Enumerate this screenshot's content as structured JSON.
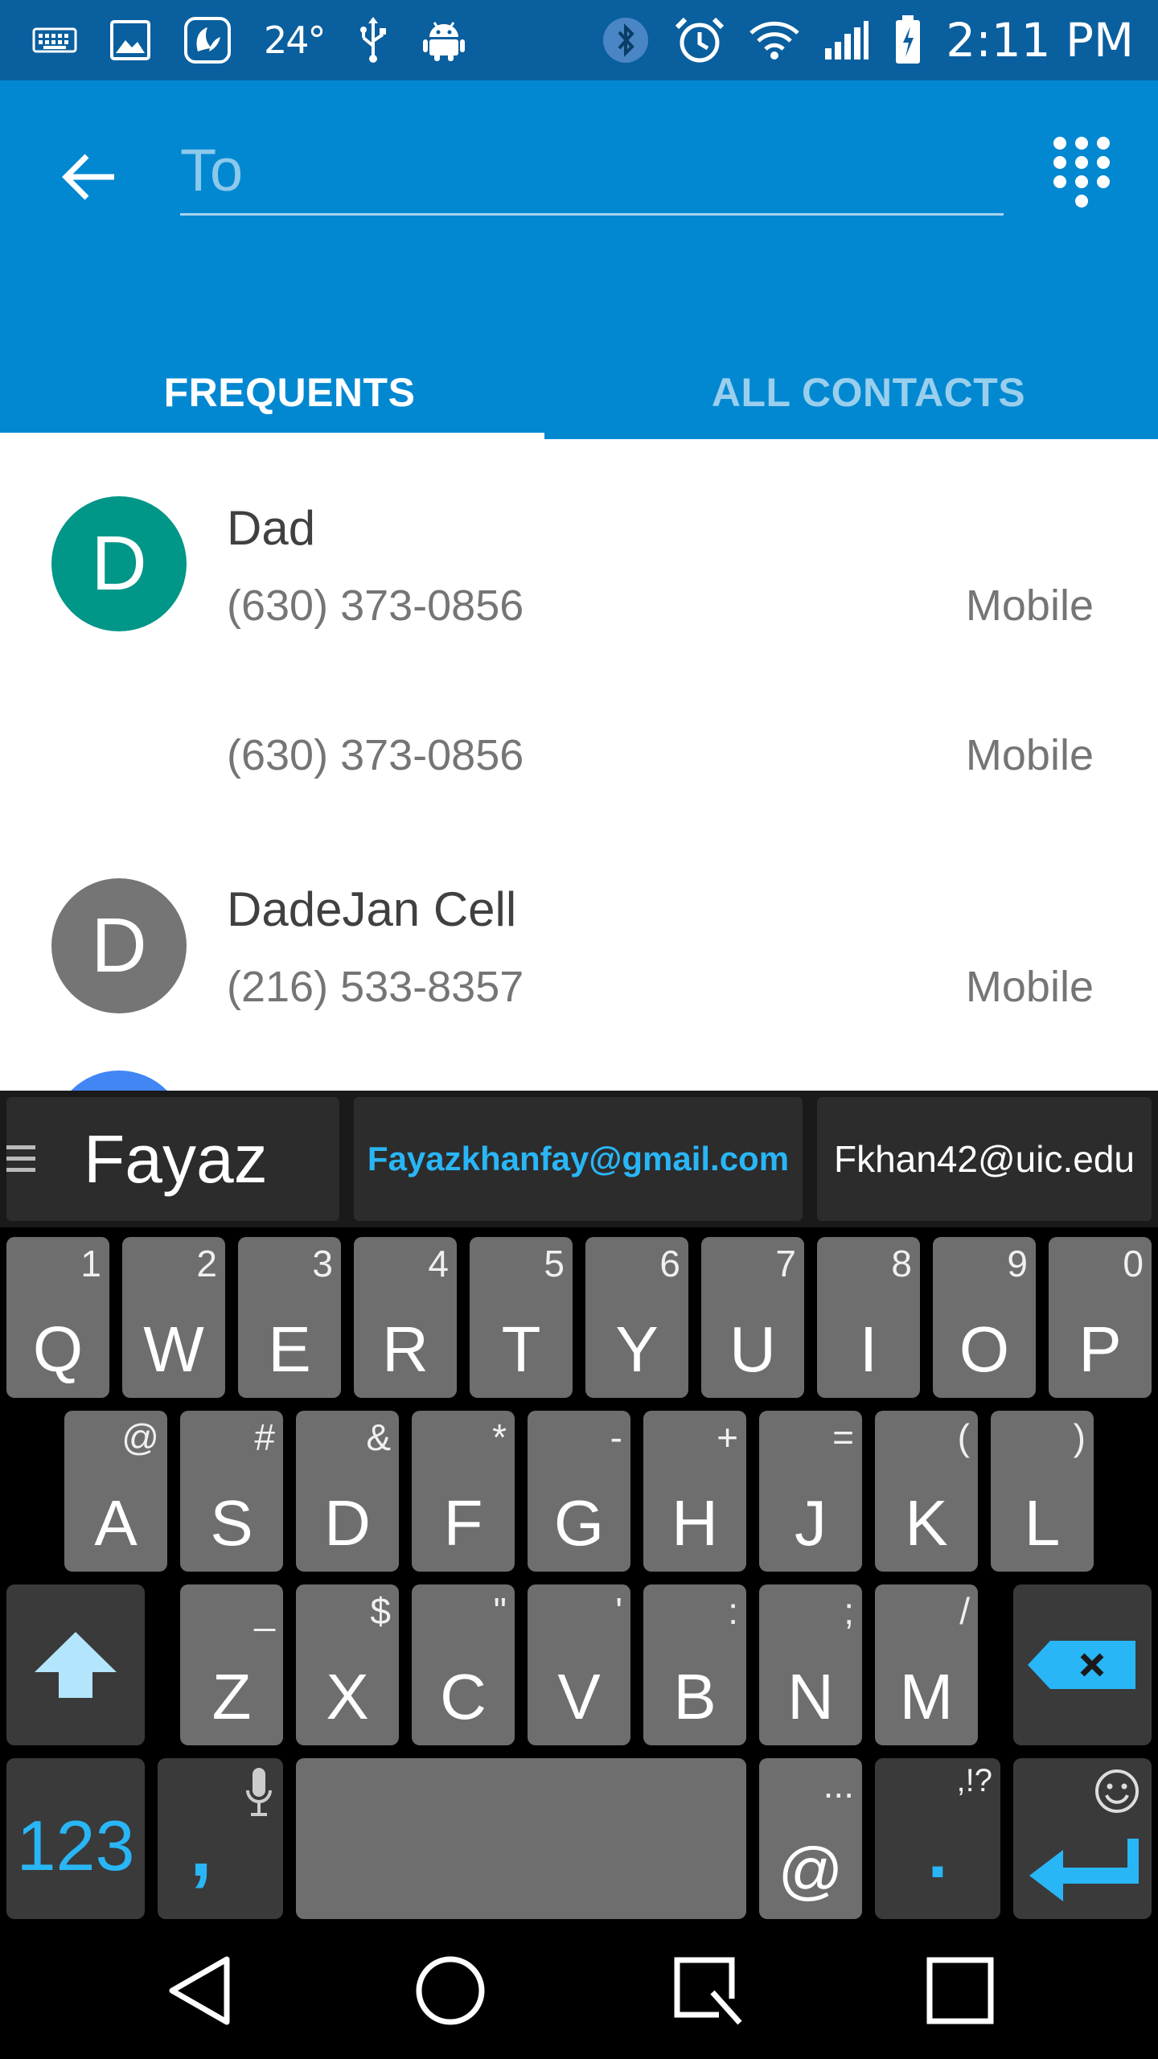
{
  "status_bar": {
    "temperature": "24°",
    "time": "2:11 PM",
    "left_icons": [
      "keyboard-icon",
      "image-icon",
      "saavn-icon",
      "usb-icon",
      "android-icon"
    ],
    "right_icons": [
      "bluetooth-icon",
      "alarm-icon",
      "wifi-icon",
      "signal-icon",
      "battery-charging-icon"
    ]
  },
  "app_bar": {
    "to_placeholder": "To",
    "to_value": "",
    "back_icon": "arrow-back-icon",
    "dialpad_icon": "dialpad-icon",
    "background_color": "#0288d1"
  },
  "tabs": [
    {
      "label": "FREQUENTS",
      "active": true
    },
    {
      "label": "ALL CONTACTS",
      "active": false
    }
  ],
  "contacts": [
    {
      "initial": "D",
      "name": "Dad",
      "phone": "(630) 373-0856",
      "type": "Mobile",
      "avatar_color": "#009688"
    },
    {
      "initial": "",
      "name": "",
      "phone": "(630) 373-0856",
      "type": "Mobile",
      "avatar_color": ""
    },
    {
      "initial": "D",
      "name": "DadeJan Cell",
      "phone": "(216) 533-8357",
      "type": "Mobile",
      "avatar_color": "#757575"
    }
  ],
  "keyboard": {
    "suggestions": [
      "Fayaz",
      "Fayazkhanfay@gmail.com",
      "Fkhan42@uic.edu"
    ],
    "row1": [
      {
        "key": "Q",
        "hint": "1"
      },
      {
        "key": "W",
        "hint": "2"
      },
      {
        "key": "E",
        "hint": "3"
      },
      {
        "key": "R",
        "hint": "4"
      },
      {
        "key": "T",
        "hint": "5"
      },
      {
        "key": "Y",
        "hint": "6"
      },
      {
        "key": "U",
        "hint": "7"
      },
      {
        "key": "I",
        "hint": "8"
      },
      {
        "key": "O",
        "hint": "9"
      },
      {
        "key": "P",
        "hint": "0"
      }
    ],
    "row2": [
      {
        "key": "A",
        "hint": "@"
      },
      {
        "key": "S",
        "hint": "#"
      },
      {
        "key": "D",
        "hint": "&"
      },
      {
        "key": "F",
        "hint": "*"
      },
      {
        "key": "G",
        "hint": "-"
      },
      {
        "key": "H",
        "hint": "+"
      },
      {
        "key": "J",
        "hint": "="
      },
      {
        "key": "K",
        "hint": "("
      },
      {
        "key": "L",
        "hint": ")"
      }
    ],
    "row3": [
      {
        "key": "Z",
        "hint": "_"
      },
      {
        "key": "X",
        "hint": "$"
      },
      {
        "key": "C",
        "hint": "\""
      },
      {
        "key": "V",
        "hint": "'"
      },
      {
        "key": "B",
        "hint": ":"
      },
      {
        "key": "N",
        "hint": ";"
      },
      {
        "key": "M",
        "hint": "/"
      }
    ],
    "row4": {
      "numbers": "123",
      "comma": ",",
      "at": "@",
      "at_hint": "...",
      "period": ".",
      "period_hint": ",!?"
    },
    "accent_color": "#29b6f6"
  },
  "nav_bar": {
    "icons": [
      "back-triangle-icon",
      "home-circle-icon",
      "quick-memo-icon",
      "recents-square-icon"
    ]
  }
}
